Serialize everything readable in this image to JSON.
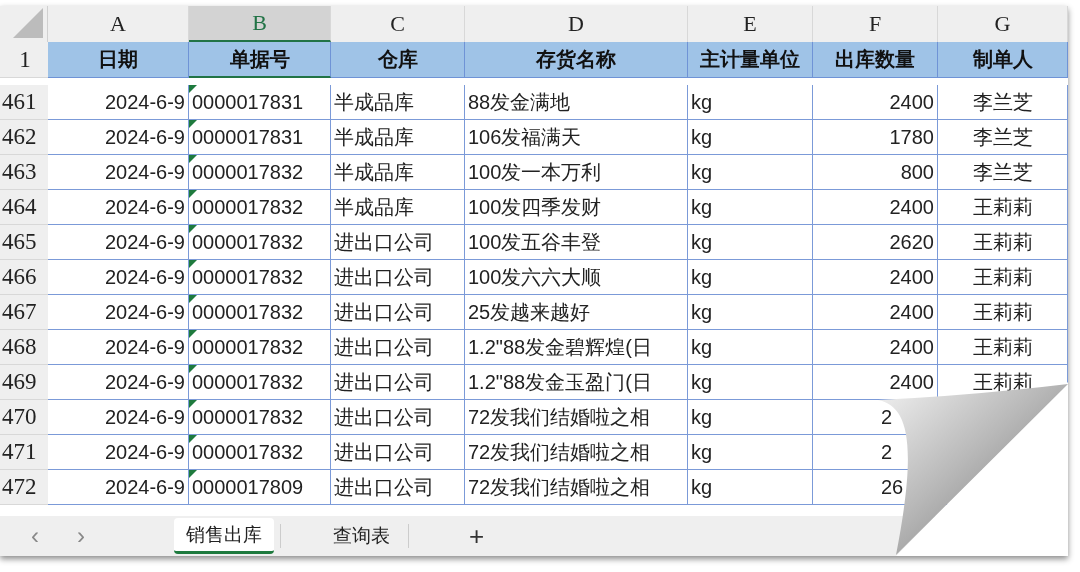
{
  "columns": [
    {
      "letter": "A",
      "selected": false
    },
    {
      "letter": "B",
      "selected": true
    },
    {
      "letter": "C",
      "selected": false
    },
    {
      "letter": "D",
      "selected": false
    },
    {
      "letter": "E",
      "selected": false
    },
    {
      "letter": "F",
      "selected": false
    },
    {
      "letter": "G",
      "selected": false
    }
  ],
  "header": {
    "row": "1",
    "cells": [
      "日期",
      "单据号",
      "仓库",
      "存货名称",
      "主计量单位",
      "出库数量",
      "制单人"
    ]
  },
  "rows": [
    {
      "row": "461",
      "date": "2024-6-9",
      "doc_no": "0000017831",
      "text_flag": true,
      "warehouse": "半成品库",
      "item": "88发金满地",
      "unit": "kg",
      "qty": "2400",
      "maker": "李兰芝",
      "covered": false
    },
    {
      "row": "462",
      "date": "2024-6-9",
      "doc_no": "0000017831",
      "text_flag": true,
      "warehouse": "半成品库",
      "item": "106发福满天",
      "unit": "kg",
      "qty": "1780",
      "maker": "李兰芝",
      "covered": false
    },
    {
      "row": "463",
      "date": "2024-6-9",
      "doc_no": "0000017832",
      "text_flag": true,
      "warehouse": "半成品库",
      "item": "100发一本万利",
      "unit": "kg",
      "qty": "800",
      "maker": "李兰芝",
      "covered": false
    },
    {
      "row": "464",
      "date": "2024-6-9",
      "doc_no": "0000017832",
      "text_flag": true,
      "warehouse": "半成品库",
      "item": "100发四季发财",
      "unit": "kg",
      "qty": "2400",
      "maker": "王莉莉",
      "covered": false
    },
    {
      "row": "465",
      "date": "2024-6-9",
      "doc_no": "0000017832",
      "text_flag": true,
      "warehouse": "进出口公司",
      "item": "100发五谷丰登",
      "unit": "kg",
      "qty": "2620",
      "maker": "王莉莉",
      "covered": false
    },
    {
      "row": "466",
      "date": "2024-6-9",
      "doc_no": "0000017832",
      "text_flag": true,
      "warehouse": "进出口公司",
      "item": "100发六六大顺",
      "unit": "kg",
      "qty": "2400",
      "maker": "王莉莉",
      "covered": false
    },
    {
      "row": "467",
      "date": "2024-6-9",
      "doc_no": "0000017832",
      "text_flag": true,
      "warehouse": "进出口公司",
      "item": "25发越来越好",
      "unit": "kg",
      "qty": "2400",
      "maker": "王莉莉",
      "covered": false
    },
    {
      "row": "468",
      "date": "2024-6-9",
      "doc_no": "0000017832",
      "text_flag": true,
      "warehouse": "进出口公司",
      "item": "1.2\"88发金碧辉煌(日",
      "unit": "kg",
      "qty": "2400",
      "maker": "王莉莉",
      "covered": false
    },
    {
      "row": "469",
      "date": "2024-6-9",
      "doc_no": "0000017832",
      "text_flag": true,
      "warehouse": "进出口公司",
      "item": "1.2\"88发金玉盈门(日",
      "unit": "kg",
      "qty": "2400",
      "maker": "王莉莉",
      "covered": false
    },
    {
      "row": "470",
      "date": "2024-6-9",
      "doc_no": "0000017832",
      "text_flag": true,
      "warehouse": "进出口公司",
      "item": "72发我们结婚啦之相",
      "unit": "kg",
      "qty": "2",
      "covered": true
    },
    {
      "row": "471",
      "date": "2024-6-9",
      "doc_no": "0000017832",
      "text_flag": true,
      "warehouse": "进出口公司",
      "item": "72发我们结婚啦之相",
      "unit": "kg",
      "qty": "2",
      "covered": true
    },
    {
      "row": "472",
      "date": "2024-6-9",
      "doc_no": "0000017809",
      "text_flag": true,
      "warehouse": "进出口公司",
      "item": "72发我们结婚啦之相",
      "unit": "kg",
      "qty": "26",
      "covered": true
    }
  ],
  "sheet_tabs": [
    {
      "label": "销售出库",
      "selected": true
    },
    {
      "label": "查询表",
      "selected": false
    }
  ],
  "nav": {
    "prev": "‹",
    "next": "›",
    "add": "+"
  }
}
